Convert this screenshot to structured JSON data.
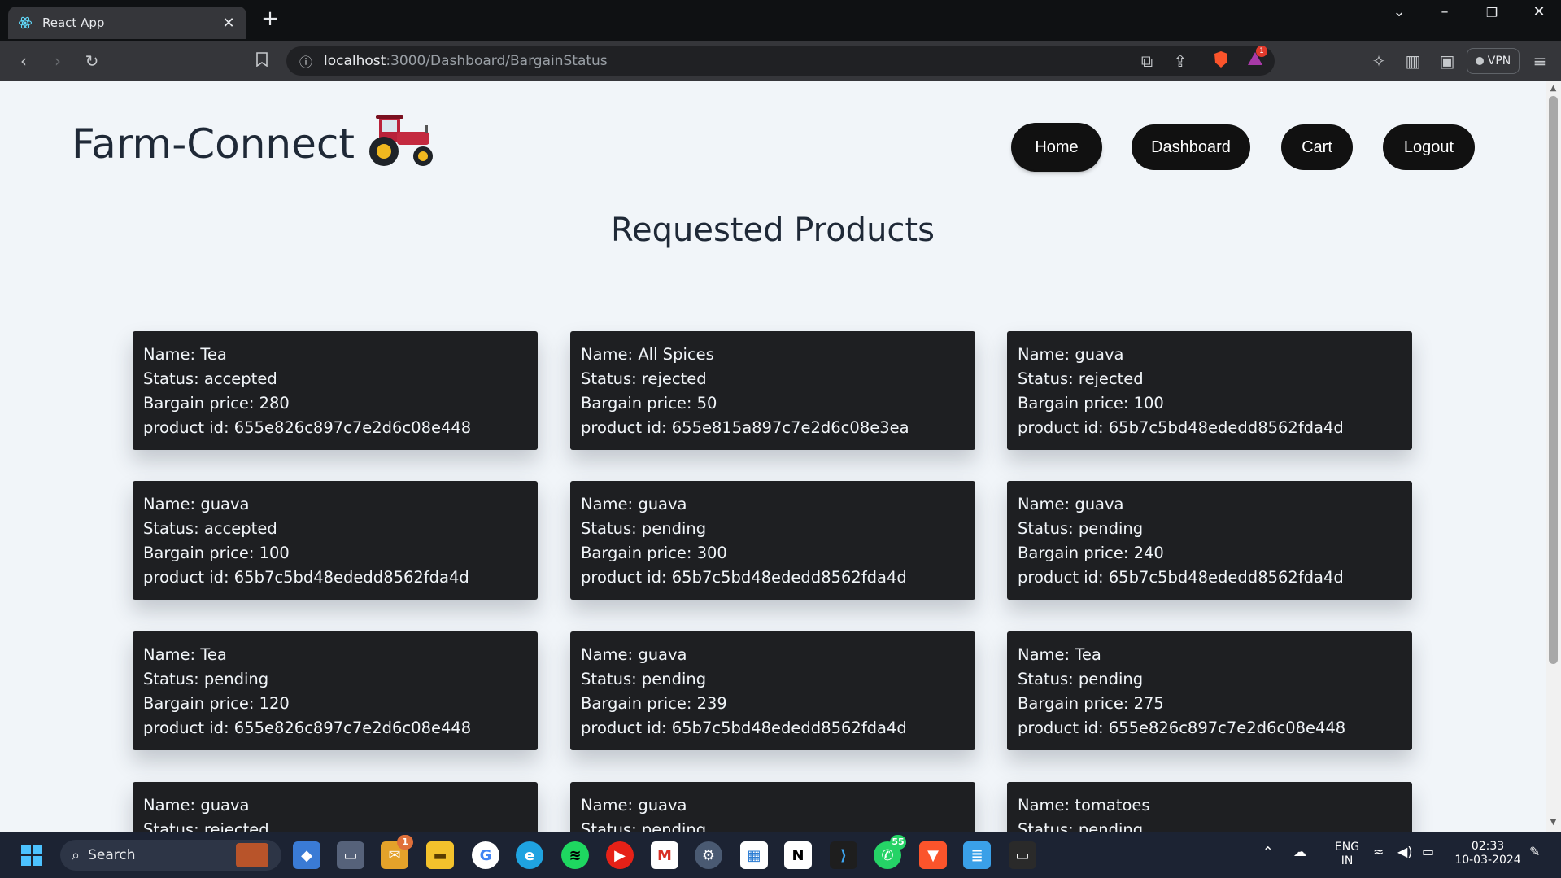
{
  "browser": {
    "tab_title": "React App",
    "url_host": "localhost",
    "url_path": ":3000/Dashboard/BargainStatus",
    "vpn_label": "VPN",
    "notification_badge": "1"
  },
  "app": {
    "brand": "Farm-Connect",
    "nav": {
      "home": "Home",
      "dashboard": "Dashboard",
      "cart": "Cart",
      "logout": "Logout"
    },
    "heading": "Requested Products"
  },
  "labels": {
    "name": "Name: ",
    "status": "Status: ",
    "price": "Bargain price: ",
    "product_id": "product id: "
  },
  "requests": [
    {
      "name": "Tea",
      "status": "accepted",
      "price": "280",
      "product_id": "655e826c897c7e2d6c08e448"
    },
    {
      "name": "All Spices",
      "status": "rejected",
      "price": "50",
      "product_id": "655e815a897c7e2d6c08e3ea"
    },
    {
      "name": "guava",
      "status": "rejected",
      "price": "100",
      "product_id": "65b7c5bd48ededd8562fda4d"
    },
    {
      "name": "guava",
      "status": "accepted",
      "price": "100",
      "product_id": "65b7c5bd48ededd8562fda4d"
    },
    {
      "name": "guava",
      "status": "pending",
      "price": "300",
      "product_id": "65b7c5bd48ededd8562fda4d"
    },
    {
      "name": "guava",
      "status": "pending",
      "price": "240",
      "product_id": "65b7c5bd48ededd8562fda4d"
    },
    {
      "name": "Tea",
      "status": "pending",
      "price": "120",
      "product_id": "655e826c897c7e2d6c08e448"
    },
    {
      "name": "guava",
      "status": "pending",
      "price": "239",
      "product_id": "65b7c5bd48ededd8562fda4d"
    },
    {
      "name": "Tea",
      "status": "pending",
      "price": "275",
      "product_id": "655e826c897c7e2d6c08e448"
    },
    {
      "name": "guava",
      "status": "rejected",
      "price": "",
      "product_id": ""
    },
    {
      "name": "guava",
      "status": "pending",
      "price": "",
      "product_id": ""
    },
    {
      "name": "tomatoes",
      "status": "pending",
      "price": "",
      "product_id": ""
    }
  ],
  "taskbar": {
    "search_placeholder": "Search",
    "language_line1": "ENG",
    "language_line2": "IN",
    "time": "02:33",
    "date": "10-03-2024",
    "whatsapp_badge": "55",
    "mail_badge": "1"
  }
}
